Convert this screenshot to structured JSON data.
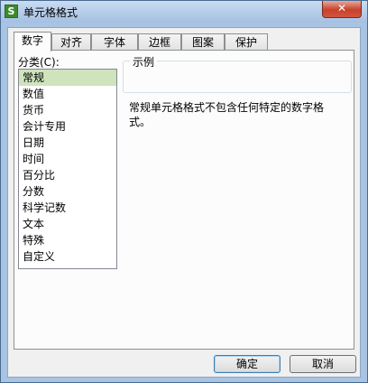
{
  "window": {
    "title": "单元格格式",
    "app_icon_glyph": "S",
    "close_glyph": "✕"
  },
  "tabs": [
    {
      "label": "数字",
      "active": true
    },
    {
      "label": "对齐",
      "active": false
    },
    {
      "label": "字体",
      "active": false
    },
    {
      "label": "边框",
      "active": false
    },
    {
      "label": "图案",
      "active": false
    },
    {
      "label": "保护",
      "active": false
    }
  ],
  "category": {
    "label": "分类(C):",
    "selected": "常规",
    "items": [
      "常规",
      "数值",
      "货币",
      "会计专用",
      "日期",
      "时间",
      "百分比",
      "分数",
      "科学记数",
      "文本",
      "特殊",
      "自定义"
    ]
  },
  "sample": {
    "legend": "示例",
    "value": ""
  },
  "description": "常规单元格格式不包含任何特定的数字格式。",
  "buttons": {
    "ok": "确定",
    "cancel": "取消"
  },
  "colors": {
    "selected_item_bg": "#cfe3bd",
    "close_button": "#c7412b"
  }
}
